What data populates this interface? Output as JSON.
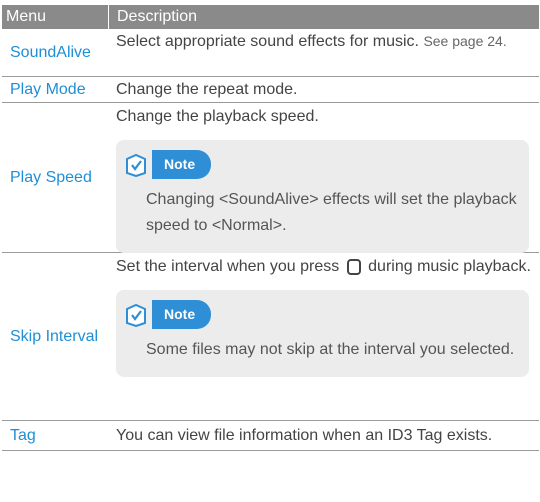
{
  "header": {
    "menu": "Menu",
    "description": "Description"
  },
  "rows": [
    {
      "menu": "SoundAlive",
      "desc": "Select appropriate sound effects for music.",
      "ref": "See page 24."
    },
    {
      "menu": "Play Mode",
      "desc": "Change the repeat mode."
    },
    {
      "menu": "Play Speed",
      "desc": "Change the playback speed.",
      "note": {
        "label": "Note",
        "text": "Changing <SoundAlive> effects will set the playback speed to <Normal>."
      }
    },
    {
      "menu": "Skip Interval",
      "desc_before": "Set the interval when you press",
      "key_icon": "home-key-icon",
      "desc_after": "during music playback.",
      "note": {
        "label": "Note",
        "text": "Some files may not skip at the interval you selected."
      }
    },
    {
      "menu": "Tag",
      "desc": "You can view file information when an ID3 Tag exists."
    }
  ],
  "colors": {
    "header_bg": "#8a8a8a",
    "menu_text": "#1e8fd6",
    "note_bg": "#ececec",
    "note_pill": "#2e8fd6"
  }
}
